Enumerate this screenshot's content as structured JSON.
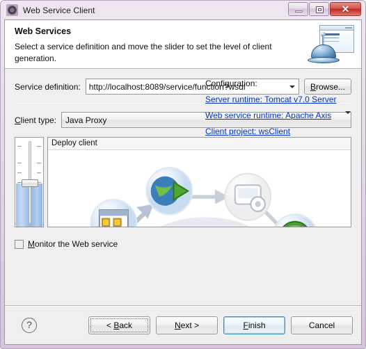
{
  "window": {
    "title": "Web Service Client",
    "icon": "webservice-icon",
    "minimize_label": "Minimize",
    "maximize_label": "Maximize",
    "close_label": "Close",
    "frame_color": "#d6c3da"
  },
  "header": {
    "title": "Web Services",
    "description": "Select a service definition and move the slider to set the level of client generation.",
    "banner_icon": "web-service-bell-icon"
  },
  "form": {
    "service_definition": {
      "label": "Service definition:",
      "value": "http://localhost:8089/service/function?wsdl",
      "browse_label": "Browse...",
      "browse_mnemonic": "B"
    },
    "client_type": {
      "label": "Client type:",
      "label_mnemonic": "C",
      "value": "Java Proxy"
    }
  },
  "slider": {
    "stage_title": "Deploy client",
    "level": "Deploy client",
    "fill_percent": 48,
    "thumb_position_percent": 48
  },
  "configuration": {
    "title": "Configuration:",
    "links": [
      {
        "label": "Server runtime: Tomcat v7.0 Server",
        "name": "server-runtime-link"
      },
      {
        "label": "Web service runtime: Apache Axis",
        "name": "web-service-runtime-link"
      },
      {
        "label": "Client project: wsClient",
        "name": "client-project-link"
      }
    ],
    "link_color": "#0033cc"
  },
  "monitor": {
    "label": "Monitor the Web service",
    "mnemonic": "M",
    "checked": false
  },
  "footer": {
    "help_label": "?",
    "buttons": [
      {
        "label": "< Back",
        "name": "back-button",
        "state": "focused"
      },
      {
        "label": "Next >",
        "name": "next-button",
        "state": "normal"
      },
      {
        "label": "Finish",
        "name": "finish-button",
        "state": "default"
      },
      {
        "label": "Cancel",
        "name": "cancel-button",
        "state": "normal"
      }
    ]
  }
}
